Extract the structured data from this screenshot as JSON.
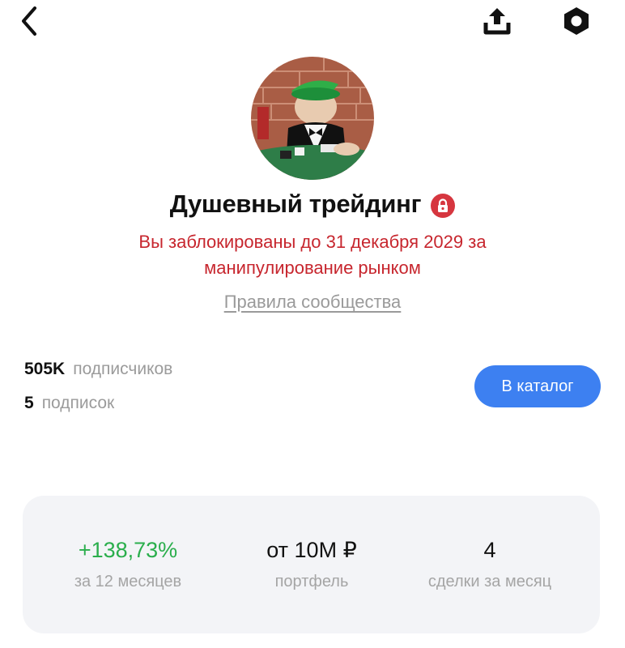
{
  "header": {
    "back_icon": "chevron-left-icon",
    "share_icon": "upload-share-icon",
    "settings_icon": "hexagon-gear-icon"
  },
  "profile": {
    "name": "Душевный трейдинг",
    "lock_icon": "lock-icon",
    "ban_message": "Вы заблокированы до 31 декабря 2029 за манипулирование рынком",
    "rules_link": "Правила сообщества",
    "followers_count": "505K",
    "followers_label": "подписчиков",
    "following_count": "5",
    "following_label": "подписок",
    "catalog_button": "В каталог"
  },
  "metrics": [
    {
      "value": "+138,73%",
      "label": "за 12 месяцев"
    },
    {
      "value": "от 10M ₽",
      "label": "портфель"
    },
    {
      "value": "4",
      "label": "сделки за месяц"
    }
  ],
  "colors": {
    "accent": "#3d80f1",
    "ban_red": "#c7262e",
    "profit_green": "#2aae4c"
  }
}
